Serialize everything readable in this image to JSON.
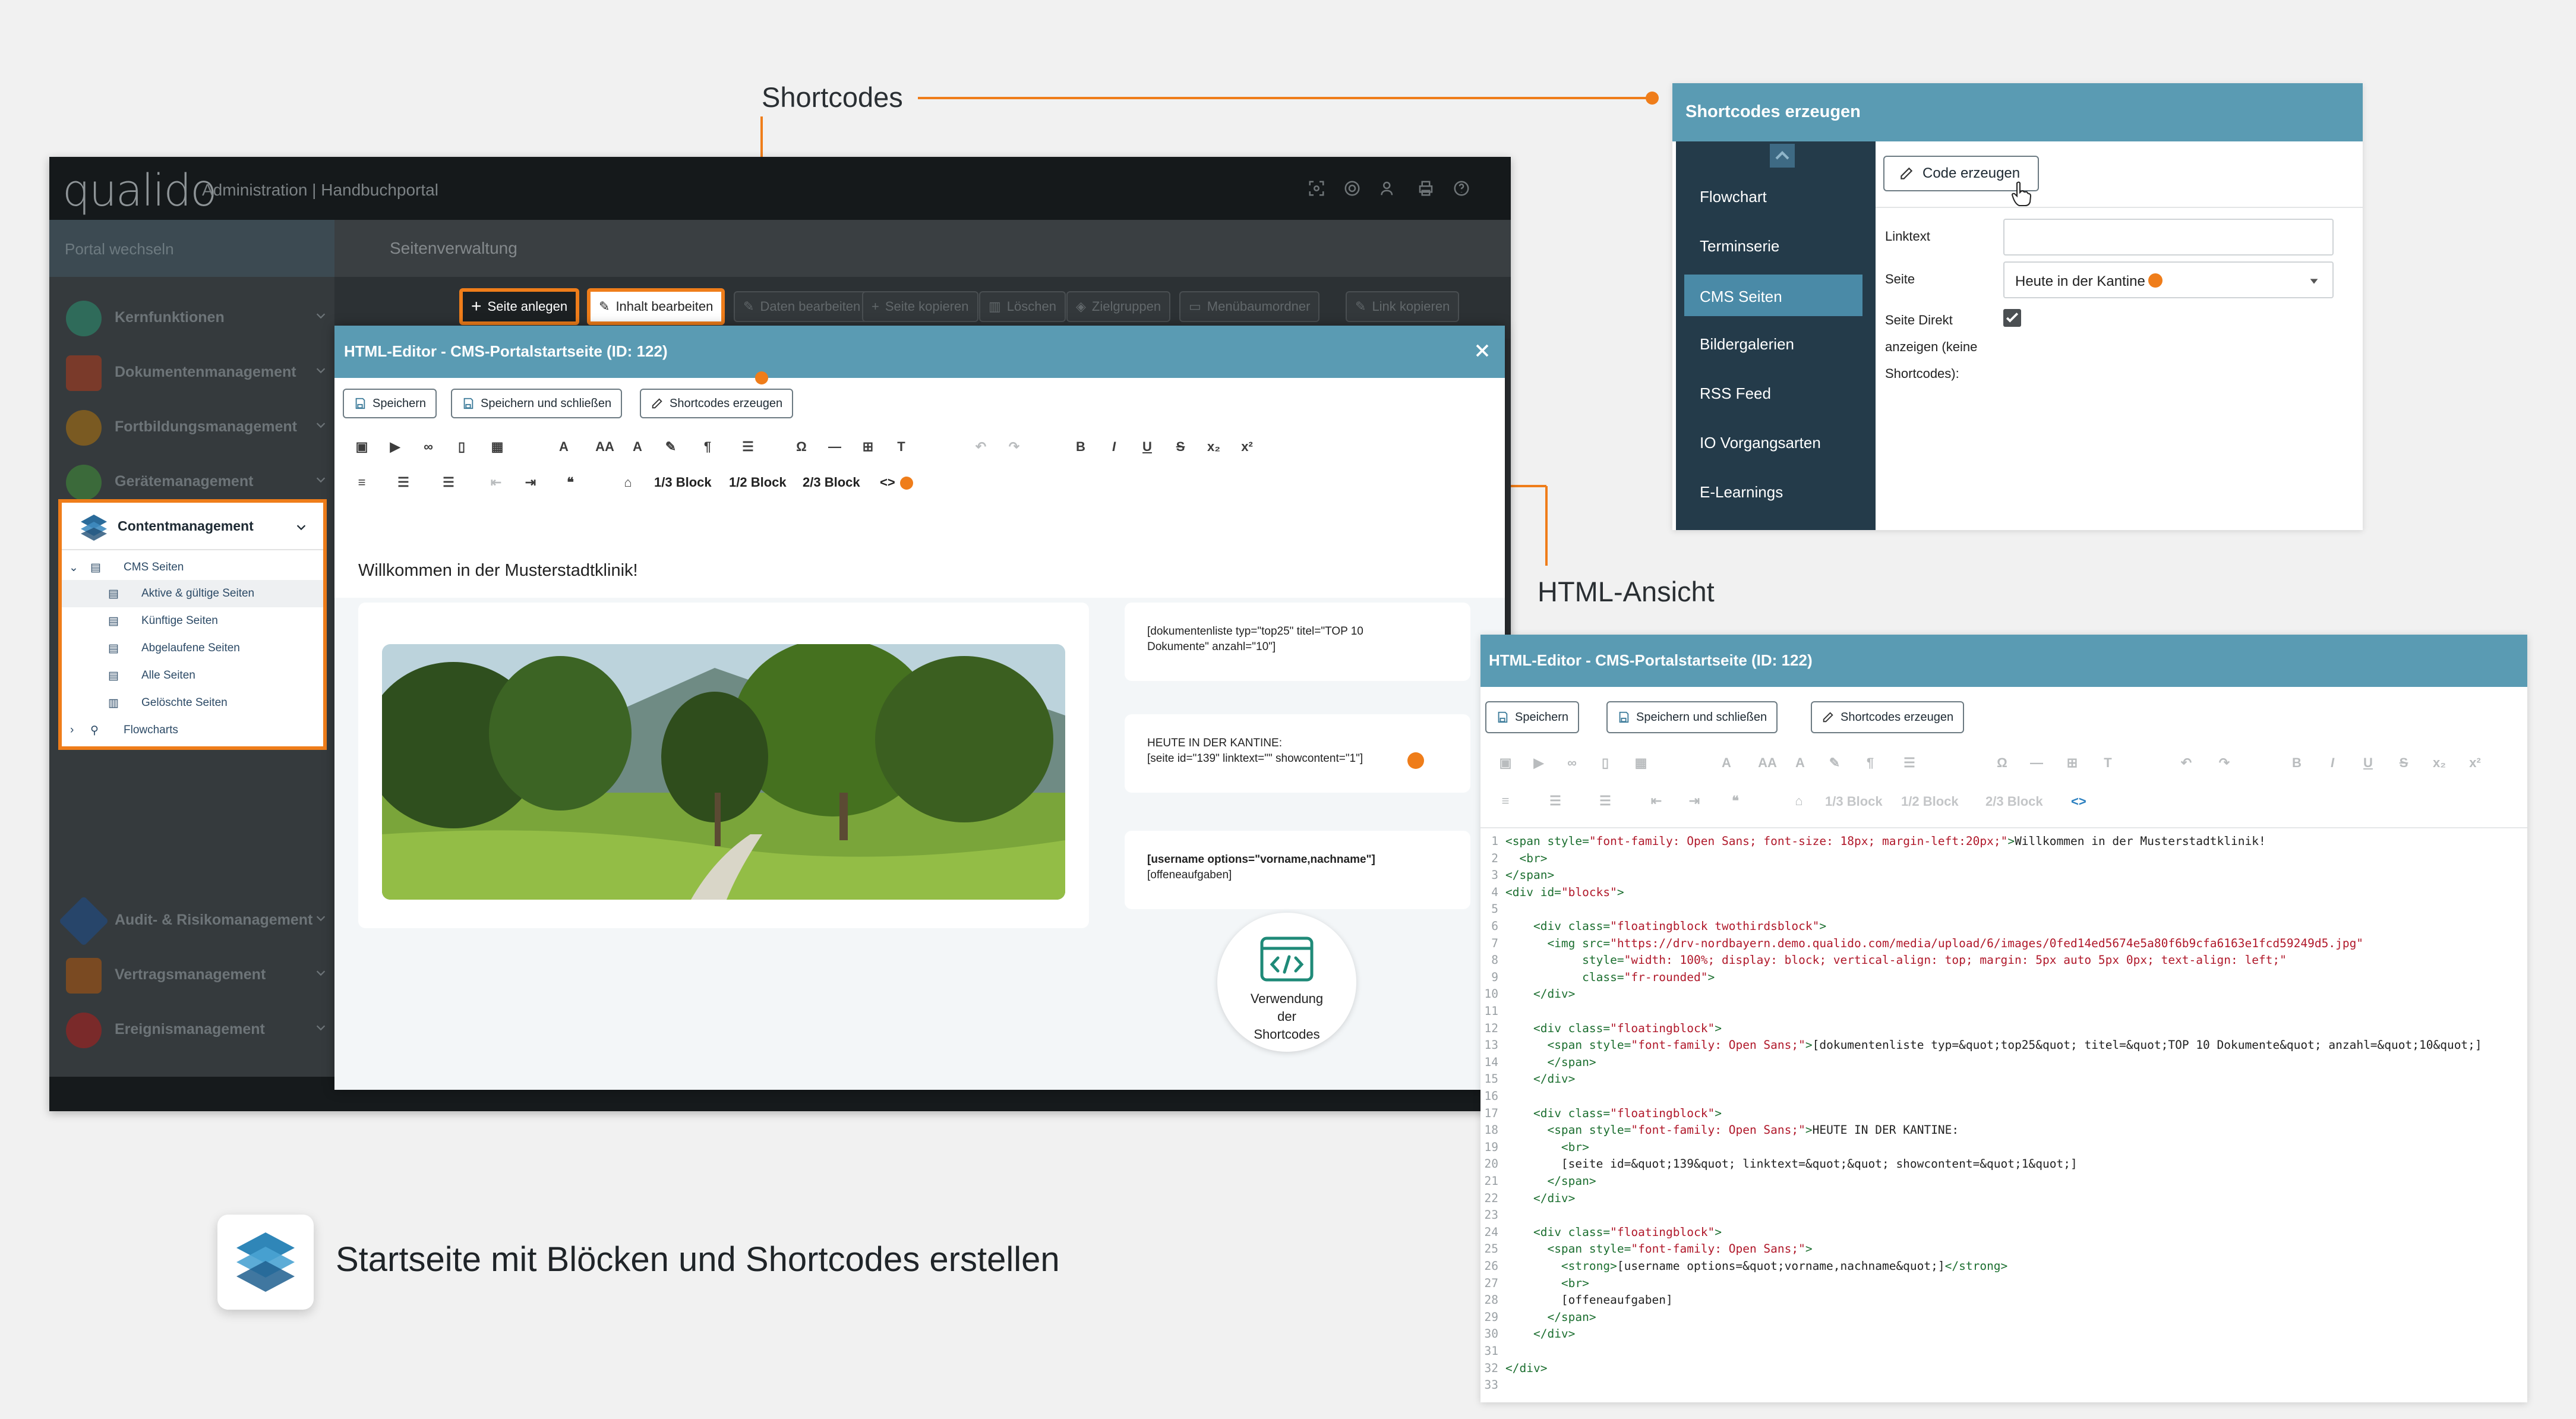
{
  "callouts": {
    "shortcodes": "Shortcodes",
    "html_view": "HTML-Ansicht"
  },
  "caption": "Startseite mit Blöcken und Shortcodes erstellen",
  "app": {
    "logo": "qualido",
    "title": "Administration | Handbuchportal",
    "portal_switch": "Portal wechseln",
    "section": "Seitenverwaltung",
    "toolbar": [
      "Seite anlegen",
      "Inhalt bearbeiten",
      "Daten bearbeiten",
      "Seite kopieren",
      "Löschen",
      "Zielgruppen",
      "Menübaumordner",
      "Link kopieren"
    ],
    "sidebar": [
      "Kernfunktionen",
      "Dokumentenmanagement",
      "Fortbildungsmanagement",
      "Gerätemanagement",
      "Contentmanagement",
      "Audit- & Risikomanagement",
      "Vertragsmanagement",
      "Ereignismanagement"
    ],
    "cms_tree": {
      "root": "CMS Seiten",
      "children": [
        "Aktive & gültige Seiten",
        "Künftige Seiten",
        "Abgelaufene Seiten",
        "Alle Seiten",
        "Gelöschte Seiten"
      ],
      "flowcharts": "Flowcharts"
    }
  },
  "editor": {
    "title": "HTML-Editor - CMS-Portalstartseite (ID: 122)",
    "buttons": [
      "Speichern",
      "Speichern und schließen",
      "Shortcodes erzeugen"
    ],
    "blocks": [
      "1/3 Block",
      "1/2 Block",
      "2/3 Block"
    ],
    "code_toggle": "<>",
    "welcome": "Willkommen in der Musterstadtklinik!",
    "cards": {
      "doclist": [
        "[dokumentenliste typ=\"top25\" titel=\"TOP 10",
        "Dokumente\" anzahl=\"10\"]"
      ],
      "kantine": [
        "HEUTE IN DER KANTINE:",
        "[seite id=\"139\" linktext=\"\" showcontent=\"1\"]"
      ],
      "user": [
        "[username options=\"vorname,nachname\"]",
        "[offeneaufgaben]"
      ]
    },
    "usage": [
      "Verwendung",
      "der",
      "Shortcodes"
    ]
  },
  "shortcode_panel": {
    "title": "Shortcodes erzeugen",
    "nav": [
      "Flowchart",
      "Terminserie",
      "CMS Seiten",
      "Bildergalerien",
      "RSS Feed",
      "IO Vorgangsarten",
      "E-Learnings"
    ],
    "active_nav": "CMS Seiten",
    "code_button": "Code erzeugen",
    "linktext_label": "Linktext",
    "linktext_value": "",
    "seite_label": "Seite",
    "seite_value": "Heute in der Kantine",
    "direct_label": [
      "Seite Direkt",
      "anzeigen (keine",
      "Shortcodes):"
    ],
    "direct_checked": true
  },
  "html_view": {
    "code": [
      [
        [
          "tg",
          "<span "
        ],
        [
          "at",
          "style="
        ],
        [
          "vl",
          "\"font-family: Open Sans; font-size: 18px; margin-left:20px;\""
        ],
        [
          "tg",
          ">"
        ],
        [
          "tx",
          "Willkommen in der Musterstadtklinik!"
        ]
      ],
      [
        [
          "tx",
          "  "
        ],
        [
          "tg",
          "<br>"
        ]
      ],
      [
        [
          "tg",
          "</span>"
        ]
      ],
      [
        [
          "tg",
          "<div "
        ],
        [
          "at",
          "id="
        ],
        [
          "vl",
          "\"blocks\""
        ],
        [
          "tg",
          ">"
        ]
      ],
      [],
      [
        [
          "tx",
          "    "
        ],
        [
          "tg",
          "<div "
        ],
        [
          "at",
          "class="
        ],
        [
          "vl",
          "\"floatingblock twothirdsblock\""
        ],
        [
          "tg",
          ">"
        ]
      ],
      [
        [
          "tx",
          "      "
        ],
        [
          "tg",
          "<img "
        ],
        [
          "at",
          "src="
        ],
        [
          "vl",
          "\"https://drv-nordbayern.demo.qualido.com/media/upload/6/images/0fed14ed5674e5a80f6b9cfa6163e1fcd59249d5.jpg\""
        ]
      ],
      [
        [
          "tx",
          "           "
        ],
        [
          "at",
          "style="
        ],
        [
          "vl",
          "\"width: 100%; display: block; vertical-align: top; margin: 5px auto 5px 0px; text-align: left;\""
        ]
      ],
      [
        [
          "tx",
          "           "
        ],
        [
          "at",
          "class="
        ],
        [
          "vl",
          "\"fr-rounded\""
        ],
        [
          "tg",
          ">"
        ]
      ],
      [
        [
          "tx",
          "    "
        ],
        [
          "tg",
          "</div>"
        ]
      ],
      [],
      [
        [
          "tx",
          "    "
        ],
        [
          "tg",
          "<div "
        ],
        [
          "at",
          "class="
        ],
        [
          "vl",
          "\"floatingblock\""
        ],
        [
          "tg",
          ">"
        ]
      ],
      [
        [
          "tx",
          "      "
        ],
        [
          "tg",
          "<span "
        ],
        [
          "at",
          "style="
        ],
        [
          "vl",
          "\"font-family: Open Sans;\""
        ],
        [
          "tg",
          ">"
        ],
        [
          "tx",
          "[dokumentenliste typ=&quot;top25&quot; titel=&quot;TOP 10 Dokumente&quot; anzahl=&quot;10&quot;]"
        ]
      ],
      [
        [
          "tx",
          "      "
        ],
        [
          "tg",
          "</span>"
        ]
      ],
      [
        [
          "tx",
          "    "
        ],
        [
          "tg",
          "</div>"
        ]
      ],
      [],
      [
        [
          "tx",
          "    "
        ],
        [
          "tg",
          "<div "
        ],
        [
          "at",
          "class="
        ],
        [
          "vl",
          "\"floatingblock\""
        ],
        [
          "tg",
          ">"
        ]
      ],
      [
        [
          "tx",
          "      "
        ],
        [
          "tg",
          "<span "
        ],
        [
          "at",
          "style="
        ],
        [
          "vl",
          "\"font-family: Open Sans;\""
        ],
        [
          "tg",
          ">"
        ],
        [
          "tx",
          "HEUTE IN DER KANTINE:"
        ]
      ],
      [
        [
          "tx",
          "        "
        ],
        [
          "tg",
          "<br>"
        ]
      ],
      [
        [
          "tx",
          "        [seite id=&quot;139&quot; linktext=&quot;&quot; showcontent=&quot;1&quot;]"
        ]
      ],
      [
        [
          "tx",
          "      "
        ],
        [
          "tg",
          "</span>"
        ]
      ],
      [
        [
          "tx",
          "    "
        ],
        [
          "tg",
          "</div>"
        ]
      ],
      [],
      [
        [
          "tx",
          "    "
        ],
        [
          "tg",
          "<div "
        ],
        [
          "at",
          "class="
        ],
        [
          "vl",
          "\"floatingblock\""
        ],
        [
          "tg",
          ">"
        ]
      ],
      [
        [
          "tx",
          "      "
        ],
        [
          "tg",
          "<span "
        ],
        [
          "at",
          "style="
        ],
        [
          "vl",
          "\"font-family: Open Sans;\""
        ],
        [
          "tg",
          ">"
        ]
      ],
      [
        [
          "tx",
          "        "
        ],
        [
          "tg",
          "<strong>"
        ],
        [
          "tx",
          "[username options=&quot;vorname,nachname&quot;]"
        ],
        [
          "tg",
          "</strong>"
        ]
      ],
      [
        [
          "tx",
          "        "
        ],
        [
          "tg",
          "<br>"
        ]
      ],
      [
        [
          "tx",
          "        [offeneaufgaben]"
        ]
      ],
      [
        [
          "tx",
          "      "
        ],
        [
          "tg",
          "</span>"
        ]
      ],
      [
        [
          "tx",
          "    "
        ],
        [
          "tg",
          "</div>"
        ]
      ],
      [],
      [
        [
          "tg",
          "</div>"
        ]
      ],
      []
    ]
  },
  "colors": {
    "accent": "#ef7d1a",
    "header": "#5a9bb3",
    "nav_dark": "#243b4a"
  }
}
